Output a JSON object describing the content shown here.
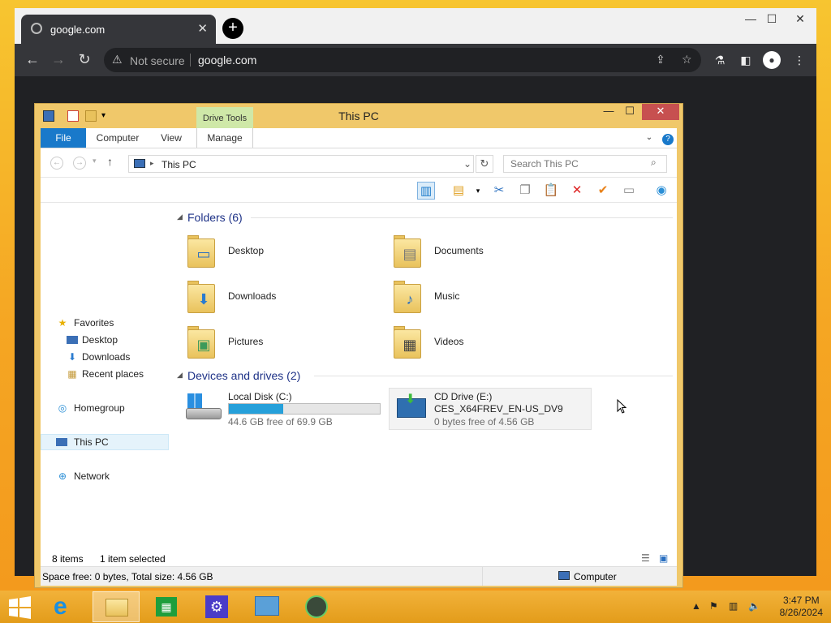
{
  "browser": {
    "tab_title": "google.com",
    "tab_close": "✕",
    "new_tab": "+",
    "security": "Not secure",
    "url": "google.com",
    "controls": {
      "minimize": "—",
      "maximize": "☐",
      "close": "✕"
    }
  },
  "explorer": {
    "title": "This PC",
    "contextual_tab": "Drive Tools",
    "tabs": [
      "File",
      "Computer",
      "View",
      "Manage"
    ],
    "controls": {
      "minimize": "—",
      "maximize": "☐",
      "close": "✕"
    },
    "breadcrumb": "This PC",
    "search_placeholder": "Search This PC",
    "help": "?",
    "nav": {
      "favorites": "Favorites",
      "desktop": "Desktop",
      "downloads": "Downloads",
      "recent": "Recent places",
      "homegroup": "Homegroup",
      "this_pc": "This PC",
      "network": "Network"
    },
    "folders_header": "Folders (6)",
    "folders": [
      "Desktop",
      "Documents",
      "Downloads",
      "Music",
      "Pictures",
      "Videos"
    ],
    "drives_header": "Devices and drives (2)",
    "drives": [
      {
        "name": "Local Disk (C:)",
        "free": "44.6 GB free of 69.9 GB",
        "used_fraction": 0.36
      },
      {
        "name": "CD Drive (E:)",
        "label": "CES_X64FREV_EN-US_DV9",
        "free": "0 bytes free of 4.56 GB"
      }
    ],
    "status": {
      "items": "8 items",
      "selected": "1 item selected",
      "space": "Space free: 0 bytes, Total size: 4.56 GB",
      "location": "Computer"
    }
  },
  "taskbar": {
    "time": "3:47 PM",
    "date": "8/26/2024"
  }
}
